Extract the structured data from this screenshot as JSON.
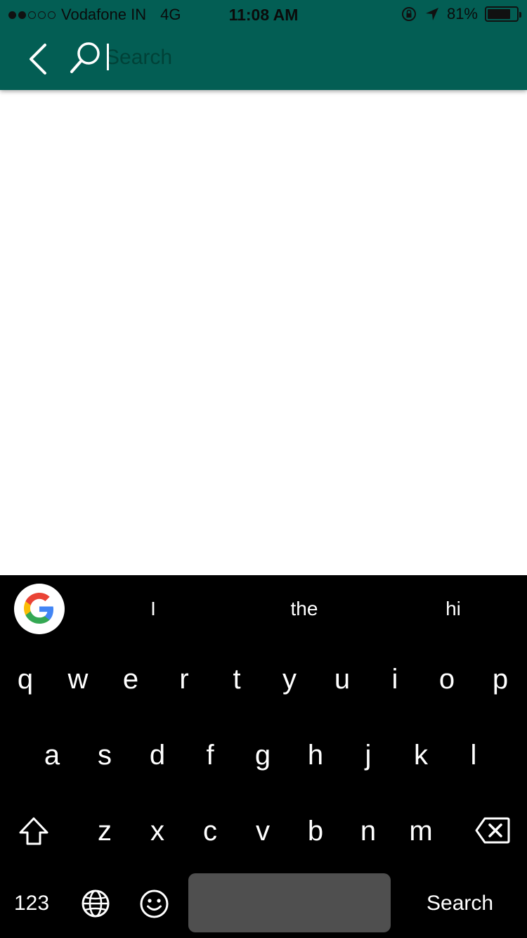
{
  "status_bar": {
    "carrier": "Vodafone IN",
    "network": "4G",
    "time": "11:08 AM",
    "battery": "81%",
    "signal_dots_filled": 2,
    "signal_dots_total": 5,
    "battery_level": 0.81
  },
  "header": {
    "background_color": "#035E54",
    "back_icon": "chevron-left-icon",
    "search_icon": "magnifier-icon",
    "search": {
      "placeholder": "Search",
      "value": ""
    }
  },
  "keyboard": {
    "suggestions": [
      "I",
      "the",
      "hi"
    ],
    "rows": [
      [
        "q",
        "w",
        "e",
        "r",
        "t",
        "y",
        "u",
        "i",
        "o",
        "p"
      ],
      [
        "a",
        "s",
        "d",
        "f",
        "g",
        "h",
        "j",
        "k",
        "l"
      ],
      [
        "z",
        "x",
        "c",
        "v",
        "b",
        "n",
        "m"
      ]
    ],
    "numbers_label": "123",
    "action_label": "Search",
    "icons": [
      "google-g-icon",
      "shift-icon",
      "backspace-icon",
      "globe-icon",
      "emoji-icon"
    ]
  }
}
